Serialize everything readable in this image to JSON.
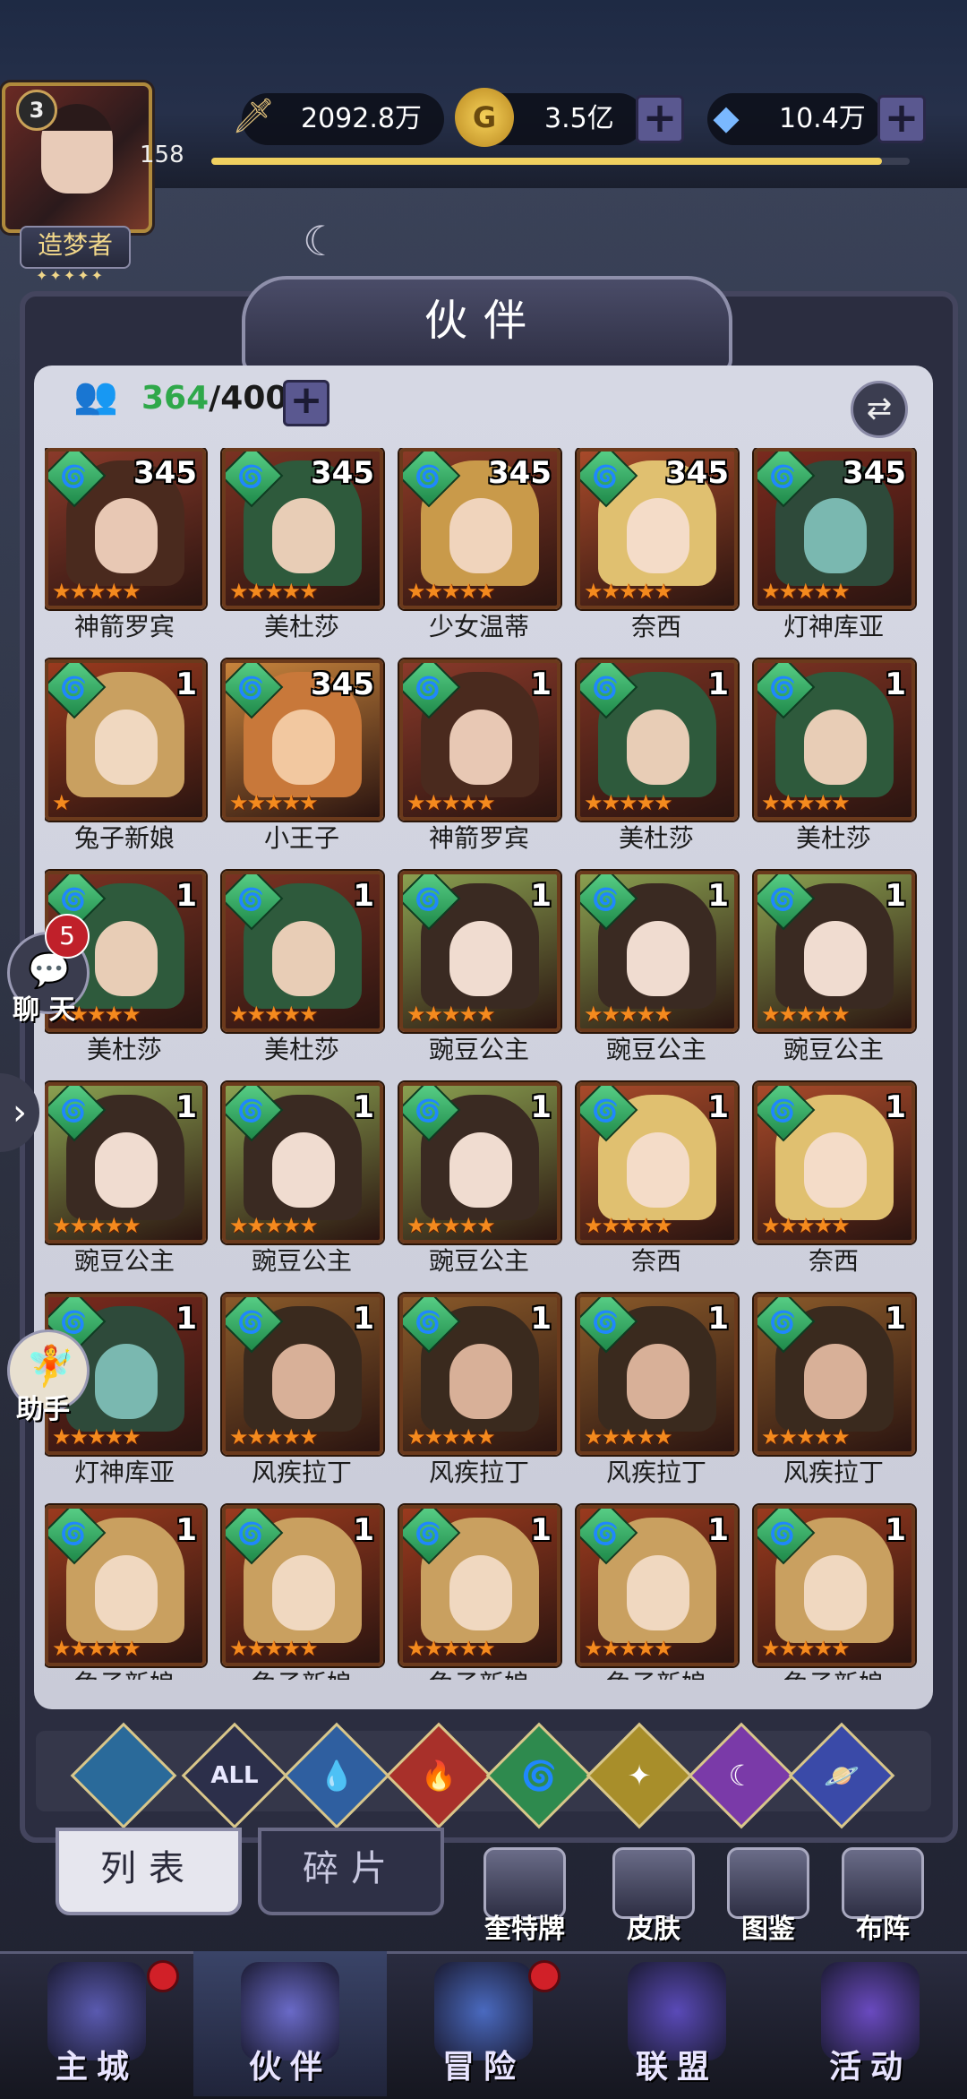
{
  "player": {
    "level": "3",
    "exp_level": "158",
    "title": "造梦者",
    "title_stars": "✦✦✦✦✦"
  },
  "resources": {
    "power": "2092.8万",
    "gold": "3.5亿",
    "diamonds": "10.4万",
    "exp_progress": 0.96
  },
  "panel": {
    "title": "伙伴"
  },
  "capacity": {
    "current": "364",
    "max": "/400"
  },
  "heroes": [
    {
      "name": "神箭罗宾",
      "level": "345",
      "stars": 5
    },
    {
      "name": "美杜莎",
      "level": "345",
      "stars": 5
    },
    {
      "name": "少女温蒂",
      "level": "345",
      "stars": 5
    },
    {
      "name": "奈西",
      "level": "345",
      "stars": 5
    },
    {
      "name": "灯神库亚",
      "level": "345",
      "stars": 5
    },
    {
      "name": "兔子新娘",
      "level": "1",
      "stars": 1
    },
    {
      "name": "小王子",
      "level": "345",
      "stars": 5
    },
    {
      "name": "神箭罗宾",
      "level": "1",
      "stars": 5
    },
    {
      "name": "美杜莎",
      "level": "1",
      "stars": 5
    },
    {
      "name": "美杜莎",
      "level": "1",
      "stars": 5
    },
    {
      "name": "美杜莎",
      "level": "1",
      "stars": 5
    },
    {
      "name": "美杜莎",
      "level": "1",
      "stars": 5
    },
    {
      "name": "豌豆公主",
      "level": "1",
      "stars": 5
    },
    {
      "name": "豌豆公主",
      "level": "1",
      "stars": 5
    },
    {
      "name": "豌豆公主",
      "level": "1",
      "stars": 5
    },
    {
      "name": "豌豆公主",
      "level": "1",
      "stars": 5
    },
    {
      "name": "豌豆公主",
      "level": "1",
      "stars": 5
    },
    {
      "name": "豌豆公主",
      "level": "1",
      "stars": 5
    },
    {
      "name": "奈西",
      "level": "1",
      "stars": 5
    },
    {
      "name": "奈西",
      "level": "1",
      "stars": 5
    },
    {
      "name": "灯神库亚",
      "level": "1",
      "stars": 5
    },
    {
      "name": "风疾拉丁",
      "level": "1",
      "stars": 5
    },
    {
      "name": "风疾拉丁",
      "level": "1",
      "stars": 5
    },
    {
      "name": "风疾拉丁",
      "level": "1",
      "stars": 5
    },
    {
      "name": "风疾拉丁",
      "level": "1",
      "stars": 5
    },
    {
      "name": "兔子新娘",
      "level": "1",
      "stars": 5
    },
    {
      "name": "兔子新娘",
      "level": "1",
      "stars": 5
    },
    {
      "name": "兔子新娘",
      "level": "1",
      "stars": 5
    },
    {
      "name": "兔子新娘",
      "level": "1",
      "stars": 5
    },
    {
      "name": "兔子新娘",
      "level": "1",
      "stars": 5
    }
  ],
  "side": {
    "chat_label": "聊 天",
    "chat_badge": "5",
    "helper_label": "助手"
  },
  "filters": [
    {
      "name": "all-element-filter",
      "label": "",
      "color": "#2a6a9a"
    },
    {
      "name": "all-filter",
      "label": "ALL",
      "color": "#2c2f4a"
    },
    {
      "name": "water-filter",
      "label": "💧",
      "color": "#2f5fa0"
    },
    {
      "name": "fire-filter",
      "label": "🔥",
      "color": "#a8302a"
    },
    {
      "name": "wind-filter",
      "label": "🌀",
      "color": "#2e8a4e"
    },
    {
      "name": "light-filter",
      "label": "✦",
      "color": "#a88e2a"
    },
    {
      "name": "dark-filter",
      "label": "☾",
      "color": "#7a3aa8"
    },
    {
      "name": "space-filter",
      "label": "🪐",
      "color": "#3a4aa8"
    }
  ],
  "subtabs": {
    "list": "列表",
    "fragments": "碎片"
  },
  "tools": [
    {
      "label": "奎特牌"
    },
    {
      "label": "皮肤"
    },
    {
      "label": "图鉴"
    },
    {
      "label": "布阵"
    }
  ],
  "nav": [
    {
      "label": "主城"
    },
    {
      "label": "伙伴"
    },
    {
      "label": "冒险"
    },
    {
      "label": "联盟"
    },
    {
      "label": "活动"
    }
  ],
  "hero_styles": {
    "神箭罗宾": {
      "bg": "#8a3a2a",
      "hair": "#4a2a1e",
      "face": "#e8c8b4"
    },
    "美杜莎": {
      "bg": "#7a3222",
      "hair": "#2e5a3c",
      "face": "#e8cdb6"
    },
    "少女温蒂": {
      "bg": "#8a3a26",
      "hair": "#c99a4a",
      "face": "#f0d4bc"
    },
    "奈西": {
      "bg": "#a84a2a",
      "hair": "#e0c070",
      "face": "#f4dcc8"
    },
    "灯神库亚": {
      "bg": "#7a2a1e",
      "hair": "#2e4a3a",
      "face": "#7ab8b0"
    },
    "兔子新娘": {
      "bg": "#9a3a1e",
      "hair": "#c9a060",
      "face": "#f0d8c0"
    },
    "小王子": {
      "bg": "#c8843c",
      "hair": "#c8783a",
      "face": "#f2c8a0"
    },
    "豌豆公主": {
      "bg": "#8aa050",
      "hair": "#3a2a22",
      "face": "#f0dcd0"
    },
    "风疾拉丁": {
      "bg": "#8a5a2a",
      "hair": "#3a2a1e",
      "face": "#d8b098"
    }
  }
}
